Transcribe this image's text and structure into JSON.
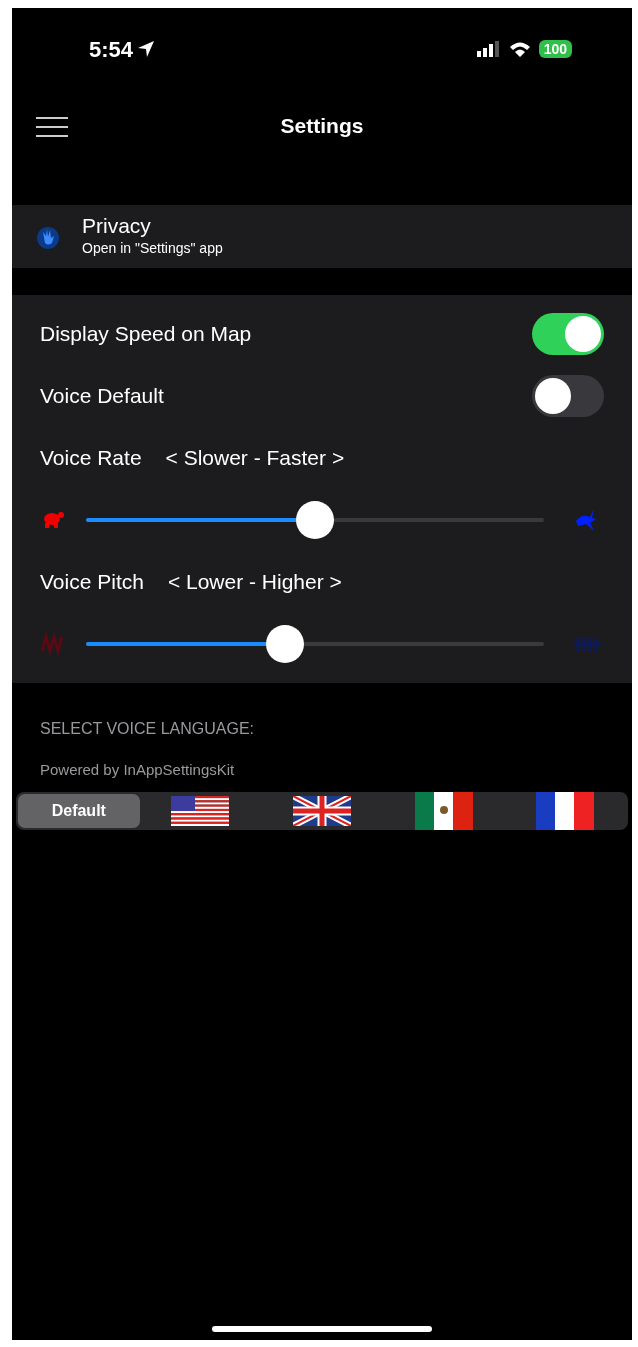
{
  "status_bar": {
    "time": "5:54",
    "battery": "100"
  },
  "nav": {
    "title": "Settings"
  },
  "privacy": {
    "title": "Privacy",
    "subtitle": "Open in \"Settings\" app"
  },
  "settings": [
    {
      "kind": "toggle",
      "label": "Display Speed on Map",
      "on": true
    },
    {
      "kind": "toggle",
      "label": "Voice Default",
      "on": false
    },
    {
      "kind": "caption",
      "label": "Voice Rate",
      "hint": "< Slower - Faster >"
    },
    {
      "kind": "rate",
      "level": 0.5
    },
    {
      "kind": "caption",
      "label": "Voice Pitch",
      "hint": "< Lower - Higher >"
    },
    {
      "kind": "pitch",
      "level": 0.435
    }
  ],
  "language": {
    "header": "SELECT VOICE LANGUAGE:",
    "footer": "Powered by InAppSettingsKit",
    "segments": [
      {
        "kind": "label",
        "label": "Default",
        "selected": true
      },
      {
        "kind": "us",
        "selected": false
      },
      {
        "kind": "uk",
        "selected": false
      },
      {
        "kind": "mx",
        "selected": false
      },
      {
        "kind": "fr",
        "selected": false
      }
    ]
  }
}
